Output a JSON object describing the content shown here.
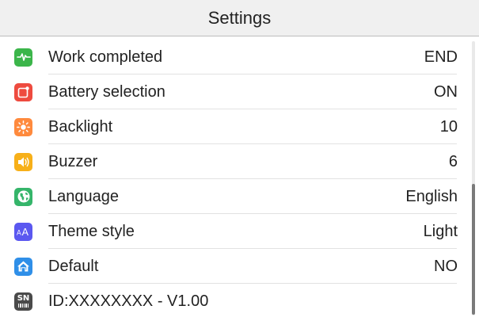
{
  "header": {
    "title": "Settings"
  },
  "settings": {
    "items": [
      {
        "label": "Work completed",
        "value": "END",
        "icon": "pulse-icon",
        "color": "#3bb54a"
      },
      {
        "label": "Battery selection",
        "value": "ON",
        "icon": "battery-select-icon",
        "color": "#ee4b3f"
      },
      {
        "label": "Backlight",
        "value": "10",
        "icon": "sun-icon",
        "color": "#ff8a3d"
      },
      {
        "label": "Buzzer",
        "value": "6",
        "icon": "speaker-icon",
        "color": "#f7b019"
      },
      {
        "label": "Language",
        "value": "English",
        "icon": "globe-icon",
        "color": "#35b56a"
      },
      {
        "label": "Theme style",
        "value": "Light",
        "icon": "font-size-icon",
        "color": "#5b58f0"
      },
      {
        "label": "Default",
        "value": "NO",
        "icon": "home-icon",
        "color": "#2f8fe8"
      },
      {
        "label": "ID:XXXXXXXX - V1.00",
        "value": "",
        "icon": "serial-number-icon",
        "color": "#4a4a4a"
      }
    ]
  },
  "icon_glyphs": {
    "serial": "SN"
  },
  "scroll": {
    "position": 0.65
  }
}
